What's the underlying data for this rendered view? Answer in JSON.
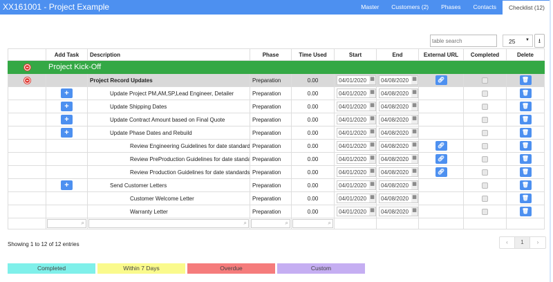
{
  "header": {
    "title": "XX161001 - Project Example",
    "tabs": [
      "Master",
      "Customers (2)",
      "Phases",
      "Contacts",
      "Checklist (12)"
    ],
    "active_tab": "Checklist (12)"
  },
  "controls": {
    "search_placeholder": "table search",
    "page_size": "25"
  },
  "columns": [
    "",
    "Add Task",
    "Description",
    "Phase",
    "Time Used",
    "Start",
    "End",
    "External URL",
    "Completed",
    "Delete"
  ],
  "group": {
    "name": "Project Kick-Off",
    "color": "#34a845"
  },
  "rows": [
    {
      "description": "Project Record Updates",
      "level": 0,
      "add_task": false,
      "phase": "Preparation",
      "time_used": "0.00",
      "start": "04/01/2020",
      "end": "04/08/2020",
      "url": true,
      "completed": false
    },
    {
      "description": "Update Project PM,AM,SP,Lead Engineer, Detailer",
      "level": 1,
      "add_task": true,
      "phase": "Preparation",
      "time_used": "0.00",
      "start": "04/01/2020",
      "end": "04/08/2020",
      "url": false,
      "completed": false
    },
    {
      "description": "Update Shipping Dates",
      "level": 1,
      "add_task": true,
      "phase": "Preparation",
      "time_used": "0.00",
      "start": "04/01/2020",
      "end": "04/08/2020",
      "url": false,
      "completed": false
    },
    {
      "description": "Update Contract Amount based on Final Quote",
      "level": 1,
      "add_task": true,
      "phase": "Preparation",
      "time_used": "0.00",
      "start": "04/01/2020",
      "end": "04/08/2020",
      "url": false,
      "completed": false
    },
    {
      "description": "Update Phase Dates and Rebuild",
      "level": 1,
      "add_task": true,
      "phase": "Preparation",
      "time_used": "0.00",
      "start": "04/01/2020",
      "end": "04/08/2020",
      "url": false,
      "completed": false
    },
    {
      "description": "Review Engineering Guidelines for date standards",
      "level": 2,
      "add_task": false,
      "phase": "Preparation",
      "time_used": "0.00",
      "start": "04/01/2020",
      "end": "04/08/2020",
      "url": true,
      "completed": false
    },
    {
      "description": "Review PreProduction Guidelines for date standards",
      "level": 2,
      "add_task": false,
      "phase": "Preparation",
      "time_used": "0.00",
      "start": "04/01/2020",
      "end": "04/08/2020",
      "url": true,
      "completed": false
    },
    {
      "description": "Review Production Guidelines for date standards",
      "level": 2,
      "add_task": false,
      "phase": "Preparation",
      "time_used": "0.00",
      "start": "04/01/2020",
      "end": "04/08/2020",
      "url": true,
      "completed": false
    },
    {
      "description": "Send Customer Letters",
      "level": 1,
      "add_task": true,
      "phase": "Preparation",
      "time_used": "0.00",
      "start": "04/01/2020",
      "end": "04/08/2020",
      "url": false,
      "completed": false
    },
    {
      "description": "Customer Welcome Letter",
      "level": 2,
      "add_task": false,
      "phase": "Preparation",
      "time_used": "0.00",
      "start": "04/01/2020",
      "end": "04/08/2020",
      "url": false,
      "completed": false
    },
    {
      "description": "Warranty Letter",
      "level": 2,
      "add_task": false,
      "phase": "Preparation",
      "time_used": "0.00",
      "start": "04/01/2020",
      "end": "04/08/2020",
      "url": false,
      "completed": false
    }
  ],
  "footer": {
    "info": "Showing 1 to 12 of 12 entries",
    "pager": [
      "‹",
      "1",
      "›"
    ],
    "current_page": "1"
  },
  "legend": [
    {
      "label": "Completed",
      "color": "#7ff0ea"
    },
    {
      "label": "Within 7 Days",
      "color": "#fafa8c"
    },
    {
      "label": "Overdue",
      "color": "#f57c7c"
    },
    {
      "label": "Custom",
      "color": "#c5aef2"
    }
  ]
}
